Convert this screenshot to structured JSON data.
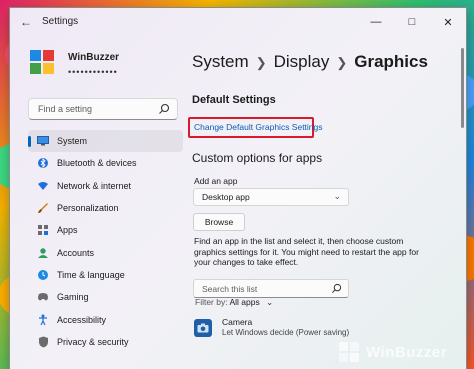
{
  "window": {
    "title": "Settings"
  },
  "profile": {
    "name": "WinBuzzer",
    "sub": "••••••••••••"
  },
  "search": {
    "placeholder": "Find a setting"
  },
  "sidebar": {
    "items": [
      {
        "label": "System",
        "icon": "system-icon",
        "active": true
      },
      {
        "label": "Bluetooth & devices",
        "icon": "bluetooth-icon"
      },
      {
        "label": "Network & internet",
        "icon": "wifi-icon"
      },
      {
        "label": "Personalization",
        "icon": "brush-icon"
      },
      {
        "label": "Apps",
        "icon": "apps-icon"
      },
      {
        "label": "Accounts",
        "icon": "person-icon"
      },
      {
        "label": "Time & language",
        "icon": "globe-clock-icon"
      },
      {
        "label": "Gaming",
        "icon": "gamepad-icon"
      },
      {
        "label": "Accessibility",
        "icon": "accessibility-icon"
      },
      {
        "label": "Privacy & security",
        "icon": "shield-icon"
      }
    ]
  },
  "breadcrumb": {
    "items": [
      "System",
      "Display",
      "Graphics"
    ]
  },
  "main": {
    "default_settings_heading": "Default Settings",
    "change_default_link": "Change Default Graphics Settings",
    "custom_heading": "Custom options for apps",
    "add_app_label": "Add an app",
    "app_type_dropdown": "Desktop app",
    "browse_button": "Browse",
    "info_text": "Find an app in the list and select it, then choose custom graphics settings for it. You might need to restart the app for your changes to take effect.",
    "search_list_placeholder": "Search this list",
    "filter_label": "Filter by:",
    "filter_value": "All apps",
    "apps": [
      {
        "name": "Camera",
        "description": "Let Windows decide (Power saving)"
      }
    ]
  },
  "watermark": {
    "text": "WinBuzzer"
  },
  "colors": {
    "accent": "#0067c0",
    "highlight_box": "#d81b2a",
    "link": "#0a5bb5"
  }
}
